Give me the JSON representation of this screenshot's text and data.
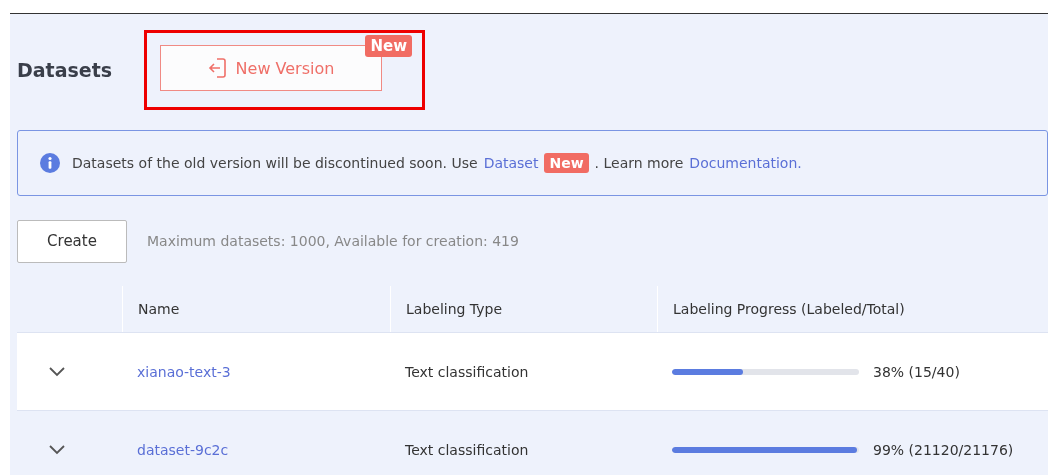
{
  "header": {
    "title": "Datasets",
    "new_version_button": {
      "label": "New Version",
      "badge": "New",
      "highlighted": true
    }
  },
  "notice": {
    "text_before": "Datasets of the old version will be discontinued soon. Use",
    "link": "Dataset",
    "badge": "New",
    "text_after": ". Learn more",
    "doc_link": "Documentation."
  },
  "toolbar": {
    "create_button": "Create",
    "quota": "Maximum datasets: 1000, Available for creation: 419"
  },
  "table": {
    "columns": [
      "Name",
      "Labeling Type",
      "Labeling Progress (Labeled/Total)"
    ],
    "rows": [
      {
        "name": "xianao-text-3",
        "type": "Text classification",
        "level": 0.38,
        "progress": "38% (15/40)",
        "highlighted": false
      },
      {
        "name": "dataset-9c2c",
        "type": "Text classification",
        "level": 0.99,
        "progress": "99% (21120/21176)",
        "highlighted": true
      }
    ]
  }
}
